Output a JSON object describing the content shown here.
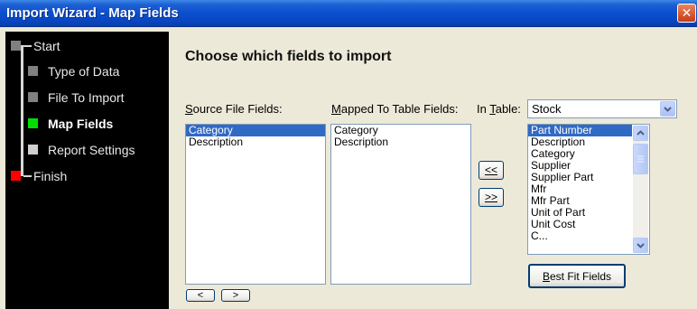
{
  "window": {
    "title": "Import Wizard - Map Fields"
  },
  "steps": [
    {
      "label": "Start",
      "status": "gray"
    },
    {
      "label": "Type of Data",
      "status": "gray"
    },
    {
      "label": "File To Import",
      "status": "gray"
    },
    {
      "label": "Map Fields",
      "status": "current"
    },
    {
      "label": "Report Settings",
      "status": "pending"
    },
    {
      "label": "Finish",
      "status": "end"
    }
  ],
  "colors": {
    "gray": "#808080",
    "current": "#00e000",
    "pending": "#d0d0d0",
    "end": "#ff0000",
    "selection": "#316ac5"
  },
  "main": {
    "heading": "Choose which fields to import",
    "source_label_prefix": "",
    "source_label_access": "S",
    "source_label_rest": "ource File Fields:",
    "mapped_label_prefix": "",
    "mapped_label_access": "M",
    "mapped_label_rest": "apped To Table Fields:",
    "table_label_prefix": "In ",
    "table_label_access": "T",
    "table_label_rest": "able:",
    "table_value": "Stock",
    "source_fields": [
      "Category",
      "Description"
    ],
    "mapped_fields": [
      "Category",
      "Description"
    ],
    "table_fields": [
      "Part Number",
      "Description",
      "Category",
      "Supplier",
      "Supplier Part",
      "Mfr",
      "Mfr Part",
      "Unit of Part",
      "Unit Cost",
      "C..."
    ],
    "move_left_label": "<<",
    "move_right_label": ">>",
    "prev_label": "<",
    "next_label": ">",
    "best_fit_access": "B",
    "best_fit_rest": "est Fit Fields"
  }
}
